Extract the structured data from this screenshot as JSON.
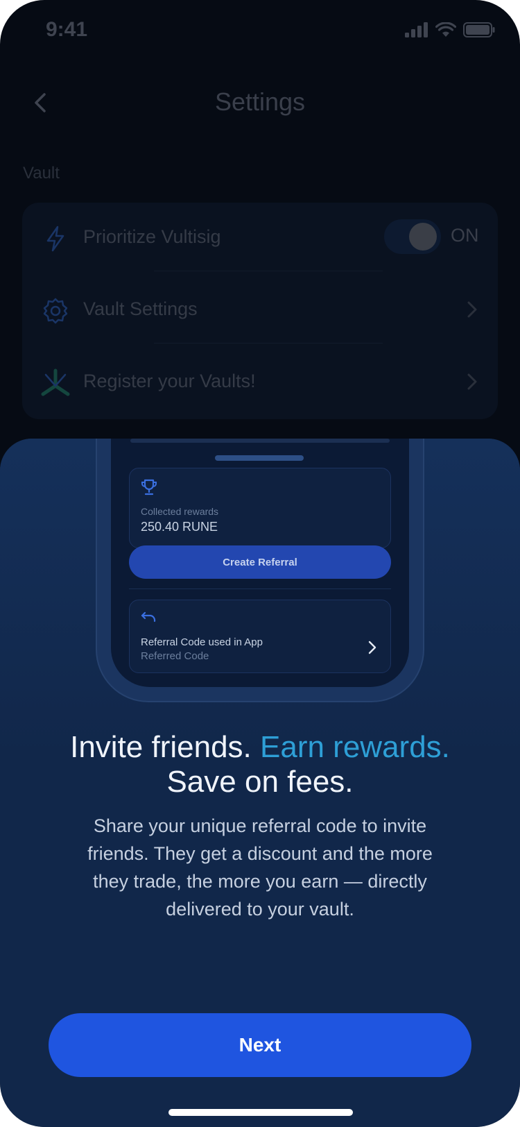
{
  "status_bar": {
    "time": "9:41"
  },
  "header": {
    "title": "Settings",
    "back_icon": "chevron-left-icon"
  },
  "vault_section": {
    "label": "Vault",
    "items": [
      {
        "icon": "lightning-icon",
        "label": "Prioritize Vultisig",
        "toggle_state": "ON",
        "toggle_on": true
      },
      {
        "icon": "gear-icon",
        "label": "Vault Settings"
      },
      {
        "icon": "vultisig-logo-icon",
        "label": "Register your Vaults!"
      }
    ]
  },
  "sheet": {
    "mockup": {
      "rewards_caption": "Collected rewards",
      "rewards_value": "250.40 RUNE",
      "create_button": "Create Referral",
      "referral_title": "Referral Code used in App",
      "referral_subtitle": "Referred Code"
    },
    "headline_part1": "Invite friends.",
    "headline_accent": "Earn rewards.",
    "headline_part2": "Save on fees.",
    "body": "Share your unique referral code to invite friends. They get a discount and the more they trade, the more you earn — directly delivered to your vault.",
    "next_button": "Next"
  },
  "colors": {
    "accent": "#2e9fd6",
    "primary_button": "#1f55e0",
    "sheet_background": "#11274a"
  }
}
